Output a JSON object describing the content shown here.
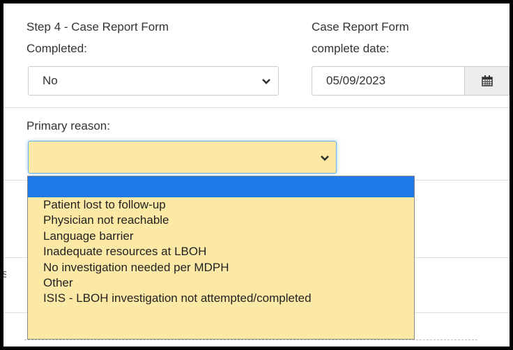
{
  "step4": {
    "label_line1": "Step 4 - Case Report Form",
    "label_line2": "Completed:",
    "value": "No"
  },
  "complete_date": {
    "label_line1": "Case Report Form",
    "label_line2": "complete date:",
    "value": "05/09/2023"
  },
  "primary_reason": {
    "label": "Primary reason:",
    "value": "",
    "options": [
      "",
      "Patient lost to follow-up",
      "Physician not reachable",
      "Language barrier",
      "Inadequate resources at LBOH",
      "No investigation needed per MDPH",
      "Other",
      "ISIS - LBOH investigation not attempted/completed"
    ]
  }
}
